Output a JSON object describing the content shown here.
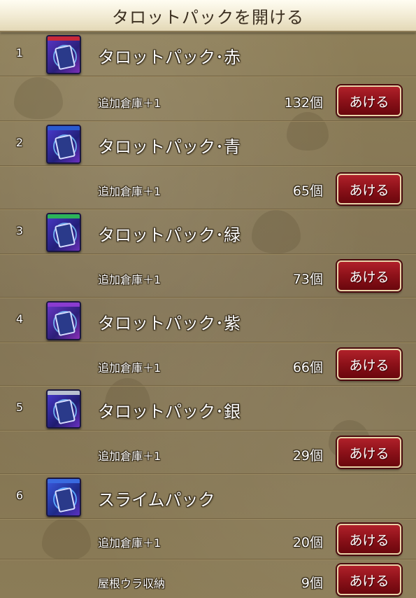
{
  "title": "タロットパックを開ける",
  "button_label": "あける",
  "items": [
    {
      "index": "1",
      "name": "タロットパック･赤",
      "effect": "追加倉庫＋1",
      "count": "132個",
      "pack_color": "#c8283a",
      "pack_icon": "tarot-pack-red-icon"
    },
    {
      "index": "2",
      "name": "タロットパック･青",
      "effect": "追加倉庫＋1",
      "count": "65個",
      "pack_color": "#2a5ad0",
      "pack_icon": "tarot-pack-blue-icon"
    },
    {
      "index": "3",
      "name": "タロットパック･緑",
      "effect": "追加倉庫＋1",
      "count": "73個",
      "pack_color": "#2bb35a",
      "pack_icon": "tarot-pack-green-icon"
    },
    {
      "index": "4",
      "name": "タロットパック･紫",
      "effect": "追加倉庫＋1",
      "count": "66個",
      "pack_color": "#8a3bd0",
      "pack_icon": "tarot-pack-purple-icon"
    },
    {
      "index": "5",
      "name": "タロットパック･銀",
      "effect": "追加倉庫＋1",
      "count": "29個",
      "pack_color": "#b8c0d0",
      "pack_icon": "tarot-pack-silver-icon"
    },
    {
      "index": "6",
      "name": "スライムパック",
      "effects": [
        {
          "effect": "追加倉庫＋1",
          "count": "20個"
        },
        {
          "effect": "屋根ウラ収納",
          "count": "9個"
        }
      ],
      "pack_color": "#3a6ae0",
      "pack_icon": "slime-pack-icon"
    }
  ]
}
